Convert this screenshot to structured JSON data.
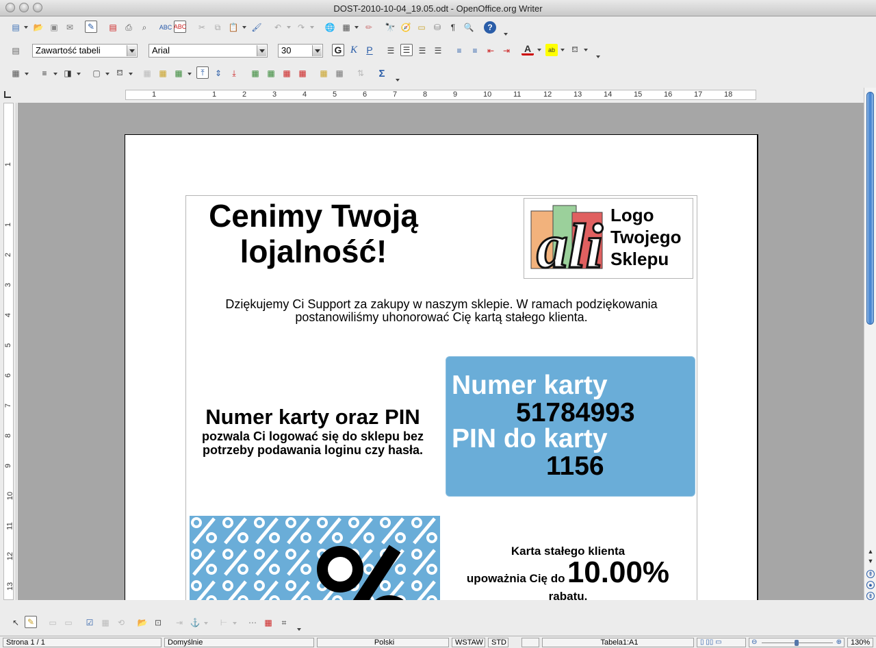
{
  "window": {
    "title": "DOST-2010-10-04_19.05.odt - OpenOffice.org Writer"
  },
  "formatting": {
    "paragraph_style": "Zawartość tabeli",
    "font_name": "Arial",
    "font_size": "30",
    "bold_label": "G",
    "italic_label": "K",
    "underline_label": "P"
  },
  "ruler": {
    "h_ticks": [
      "1",
      "1",
      "2",
      "3",
      "4",
      "5",
      "6",
      "7",
      "8",
      "9",
      "10",
      "11",
      "12",
      "13",
      "14",
      "15",
      "16",
      "17",
      "18"
    ],
    "v_ticks": [
      "1",
      "1",
      "2",
      "3",
      "4",
      "5",
      "6",
      "7",
      "8",
      "9",
      "10",
      "11",
      "12",
      "13"
    ]
  },
  "document": {
    "heading": "Cenimy Twoją lojalność!",
    "logo_text": "Logo Twojego Sklepu",
    "logo_art": "ali",
    "thanks": "Dziękujemy Ci Support za zakupy w naszym sklepie. W ramach podziękowania postanowiliśmy uhonorować Cię kartą stałego klienta.",
    "pin_title": "Numer karty oraz PIN",
    "pin_desc": "pozwala Ci logować się do sklepu bez potrzeby podawania loginu czy hasła.",
    "card_number_label": "Numer karty",
    "card_number": "51784993",
    "pin_label": "PIN do karty",
    "pin": "1156",
    "loyalty_title": "Karta stałego klienta",
    "discount_prefix": "upoważnia Cię do",
    "discount_value": "10.00%",
    "discount_suffix": "rabatu."
  },
  "colors": {
    "card_blue": "#6aadd8",
    "pattern_blue": "#6aadd8"
  },
  "statusbar": {
    "page": "Strona  1 / 1",
    "style": "Domyślnie",
    "language": "Polski",
    "insert_mode": "WSTAW",
    "selection_mode": "STD",
    "cell": "Tabela1:A1",
    "zoom": "130%"
  }
}
